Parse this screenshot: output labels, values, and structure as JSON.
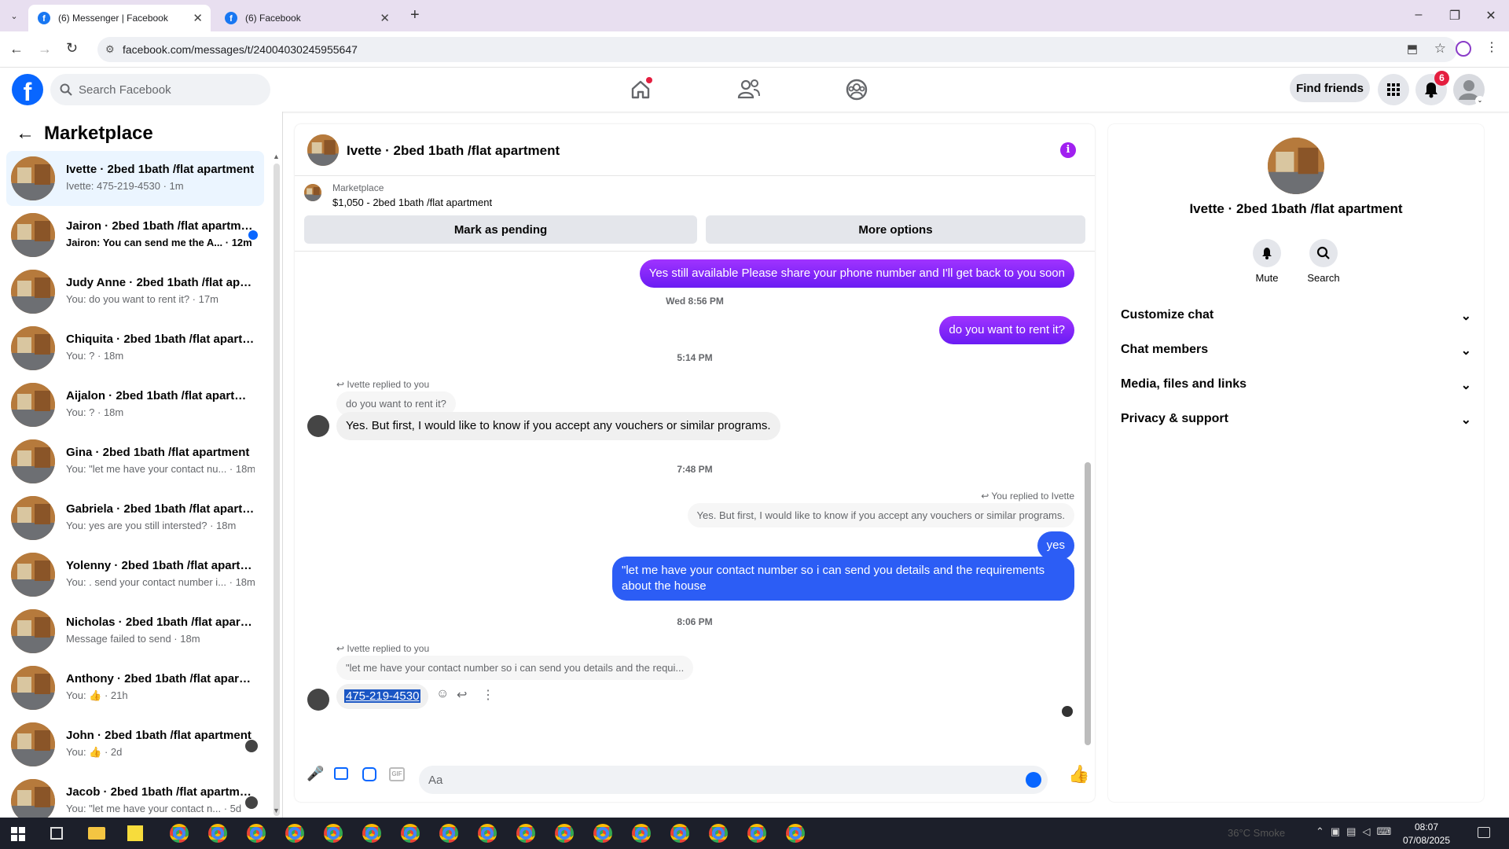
{
  "browser": {
    "tabs": [
      {
        "title": "(6) Messenger | Facebook"
      },
      {
        "title": "(6) Facebook"
      }
    ],
    "url": "facebook.com/messages/t/24004030245955647"
  },
  "fb_header": {
    "search_placeholder": "Search Facebook",
    "find_friends": "Find friends",
    "notification_count": "6"
  },
  "left_panel": {
    "title": "Marketplace",
    "conversations": [
      {
        "name": "Ivette · 2bed 1bath /flat apartment",
        "preview": "Ivette: 475-219-4530 · 1m"
      },
      {
        "name": "Jairon · 2bed 1bath /flat apartment",
        "preview": "Jairon: You can send me the A... · 12m"
      },
      {
        "name": "Judy Anne · 2bed 1bath /flat apartment",
        "preview": "You: do you want to rent it? · 17m"
      },
      {
        "name": "Chiquita · 2bed 1bath /flat apartment",
        "preview": "You: ? · 18m"
      },
      {
        "name": "Aijalon · 2bed 1bath /flat apartment",
        "preview": "You: ? · 18m"
      },
      {
        "name": "Gina · 2bed 1bath /flat apartment",
        "preview": "You: \"let me have your contact nu... · 18m"
      },
      {
        "name": "Gabriela · 2bed 1bath /flat apartment",
        "preview": "You: yes are you still intersted? · 18m"
      },
      {
        "name": "Yolenny · 2bed 1bath /flat apartment",
        "preview": "You: . send your contact number i... · 18m"
      },
      {
        "name": "Nicholas · 2bed 1bath /flat apartment",
        "preview": "Message failed to send · 18m"
      },
      {
        "name": "Anthony · 2bed 1bath /flat apartment",
        "preview": "You: 👍 · 21h"
      },
      {
        "name": "John · 2bed 1bath /flat apartment",
        "preview": "You: 👍 · 2d"
      },
      {
        "name": "Jacob · 2bed 1bath /flat apartment",
        "preview": "You: \"let me have your contact n... · 5d"
      }
    ]
  },
  "chat": {
    "title": "Ivette · 2bed 1bath /flat apartment",
    "product_label": "Marketplace",
    "product_info": "$1,050 - 2bed 1bath /flat apartment",
    "mark_pending": "Mark as pending",
    "more_options": "More options",
    "messages": {
      "m1": "Yes still available Please share your phone number and I'll get back to you soon",
      "ts1": "Wed 8:56 PM",
      "m2": "do you want to rent it?",
      "ts2": "5:14 PM",
      "reply1_label": "Ivette replied to you",
      "reply1_quote": "do you want to rent it?",
      "m3": "Yes. But first, I would like to know if you accept any vouchers or similar programs.",
      "ts3": "7:48 PM",
      "reply2_label": "You replied to Ivette",
      "reply2_quote": "Yes. But first, I would like to know if you accept any vouchers or similar programs.",
      "m4": "yes",
      "m5": "\"let me have your contact number so i can send you details and the requirements about the house",
      "ts4": "8:06 PM",
      "reply3_label": "Ivette replied to you",
      "reply3_quote": "\"let me have your contact number so i can send you details and the requi...",
      "m6": "475-219-4530"
    },
    "composer_placeholder": "Aa"
  },
  "right_panel": {
    "name": "Ivette · 2bed 1bath /flat apartment",
    "mute": "Mute",
    "search": "Search",
    "sections": [
      "Customize chat",
      "Chat members",
      "Media, files and links",
      "Privacy & support"
    ]
  },
  "taskbar": {
    "weather": "36°C  Smoke",
    "time": "08:07",
    "date": "07/08/2025"
  },
  "colors": {
    "fb_blue": "#0866ff",
    "outgoing": "#8a1cf5",
    "selection": "#ebf5ff"
  }
}
